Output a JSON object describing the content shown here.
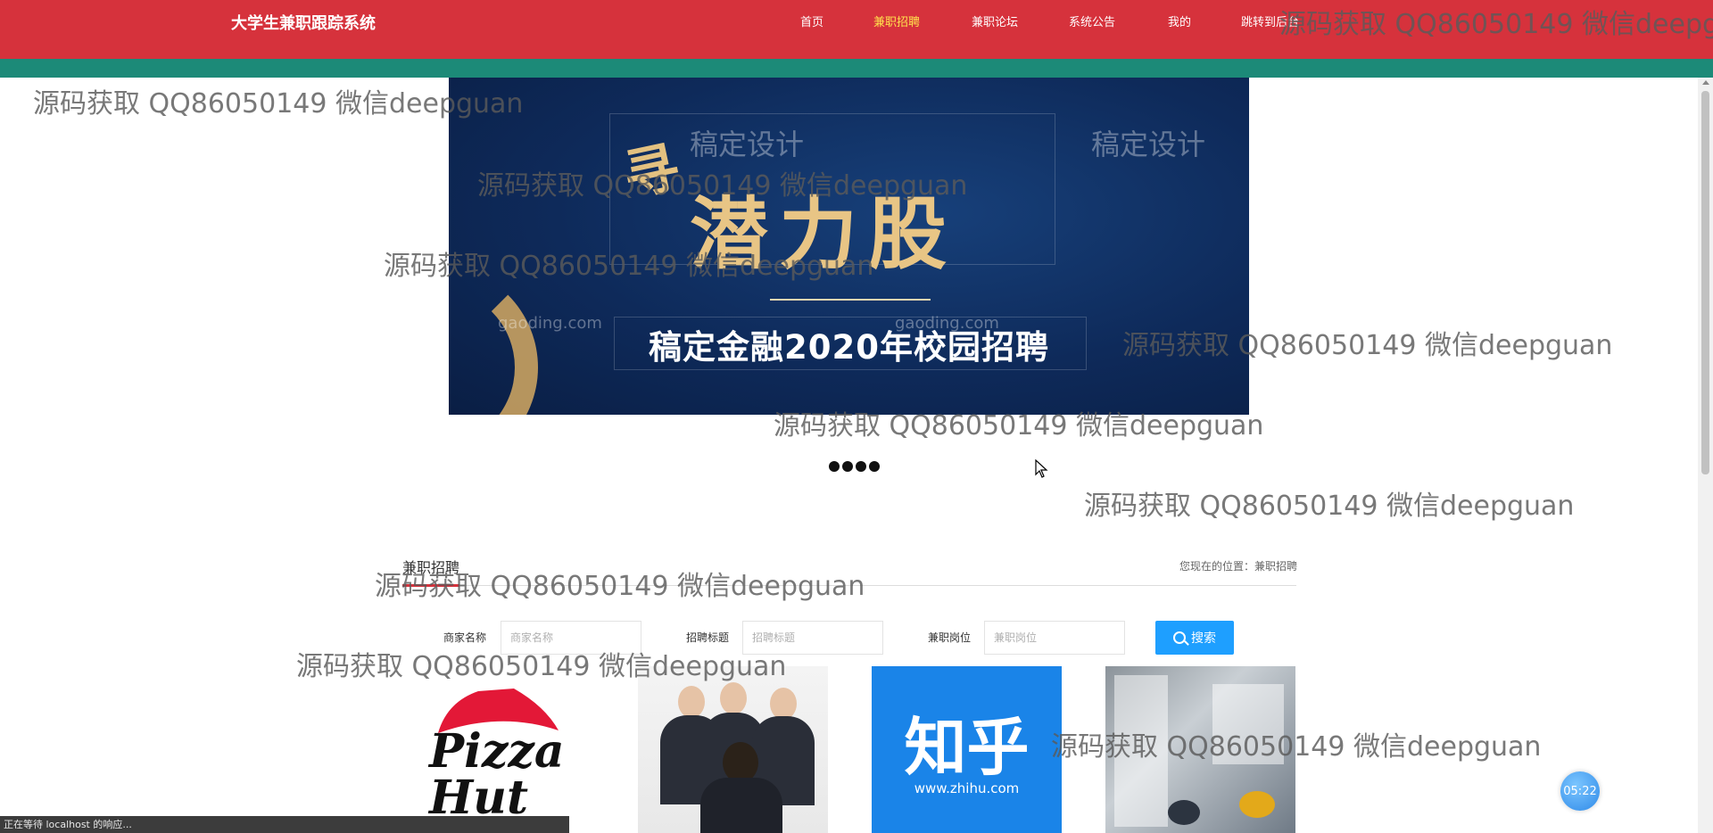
{
  "header": {
    "title": "大学生兼职跟踪系统",
    "nav": [
      {
        "label": "首页",
        "active": false
      },
      {
        "label": "兼职招聘",
        "active": true
      },
      {
        "label": "兼职论坛",
        "active": false
      },
      {
        "label": "系统公告",
        "active": false
      },
      {
        "label": "我的",
        "active": false
      },
      {
        "label": "跳转到后台",
        "active": false
      }
    ]
  },
  "banner": {
    "calligraphy_small": "寻",
    "calligraphy_main": "潜力股",
    "subtitle": "稿定金融2020年校园招聘",
    "brand_left": "稿定设计",
    "brand_right": "稿定设计",
    "domain_left": "gaoding.com",
    "domain_right": "gaoding.com",
    "dot_count": 4
  },
  "section": {
    "title": "兼职招聘",
    "breadcrumb": "您现在的位置：兼职招聘"
  },
  "filters": {
    "merchant_label": "商家名称",
    "merchant_placeholder": "商家名称",
    "title_label": "招聘标题",
    "title_placeholder": "招聘标题",
    "position_label": "兼职岗位",
    "position_placeholder": "兼职岗位",
    "search_label": "搜索"
  },
  "cards": [
    {
      "name": "pizza-hut",
      "logo_text": "Pizza Hut"
    },
    {
      "name": "business-meeting"
    },
    {
      "name": "zhihu",
      "logo_text": "知乎",
      "url_text": "www.zhihu.com"
    },
    {
      "name": "office"
    }
  ],
  "timer": "05:22",
  "status_bar": "正在等待 localhost 的响应...",
  "watermark": "源码获取 QQ86050149 微信deepguan",
  "colors": {
    "header_red": "#d6323c",
    "teal_band": "#1c8a78",
    "active_nav": "#ffe14d",
    "search_blue": "#1e9fff"
  }
}
